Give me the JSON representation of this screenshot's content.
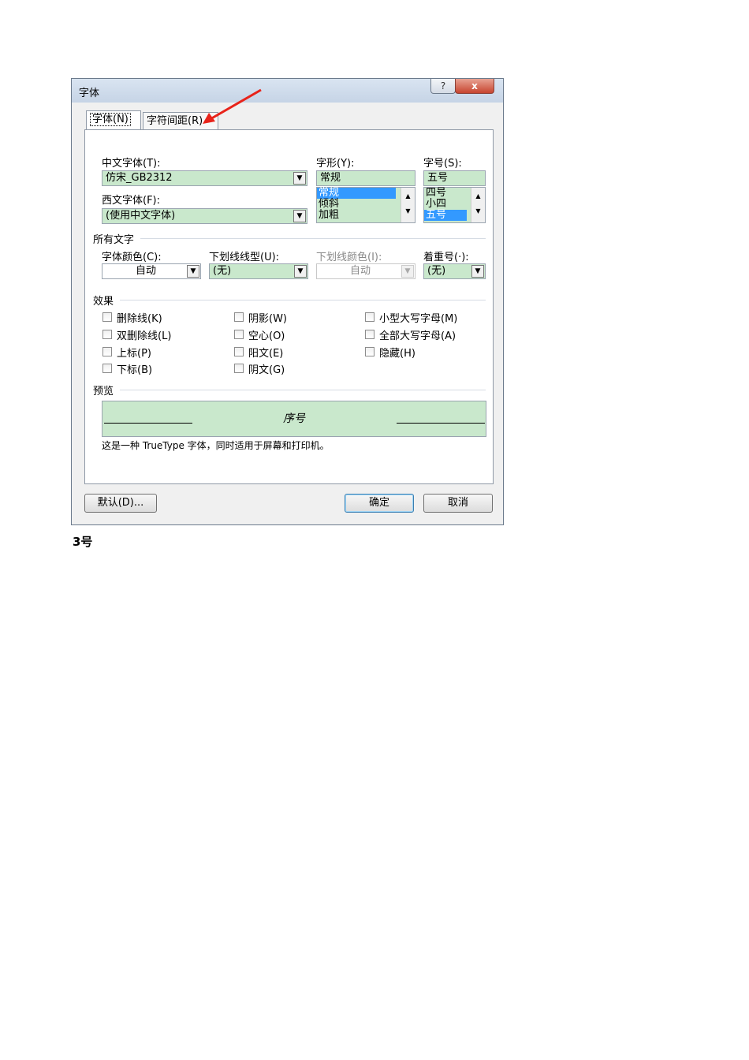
{
  "dialog": {
    "title": "字体",
    "help_label": "?",
    "close_label": "x",
    "tabs": [
      {
        "label": "字体(N)",
        "active": true
      },
      {
        "label": "字符间距(R)",
        "active": false
      }
    ],
    "font_section": {
      "chinese_font_label": "中文字体(T):",
      "chinese_font_value": "仿宋_GB2312",
      "western_font_label": "西文字体(F):",
      "western_font_value": "(使用中文字体)",
      "style_label": "字形(Y):",
      "style_value": "常规",
      "style_options": [
        "常规",
        "倾斜",
        "加粗"
      ],
      "style_selected": "常规",
      "size_label": "字号(S):",
      "size_value": "五号",
      "size_options": [
        "四号",
        "小四",
        "五号"
      ],
      "size_selected": "五号"
    },
    "all_text": {
      "heading": "所有文字",
      "font_color_label": "字体颜色(C):",
      "font_color_value": "自动",
      "underline_type_label": "下划线线型(U):",
      "underline_type_value": "(无)",
      "underline_color_label": "下划线颜色(I):",
      "underline_color_value": "自动",
      "emphasis_label": "着重号(·):",
      "emphasis_value": "(无)"
    },
    "effects": {
      "heading": "效果",
      "items": [
        "删除线(K)",
        "阴影(W)",
        "小型大写字母(M)",
        "双删除线(L)",
        "空心(O)",
        "全部大写字母(A)",
        "上标(P)",
        "阳文(E)",
        "隐藏(H)",
        "下标(B)",
        "阴文(G)"
      ]
    },
    "preview": {
      "heading": "预览",
      "sample_text": "序号",
      "description": "这是一种 TrueType 字体，同时适用于屏幕和打印机。"
    },
    "buttons": {
      "default_label": "默认(D)...",
      "ok_label": "确定",
      "cancel_label": "取消"
    }
  },
  "caption": "3号",
  "colors": {
    "field_green": "#c9e8cc",
    "selection_blue": "#3399ff",
    "annotation_arrow": "#e8231a"
  },
  "icons": {
    "annotation": "red-arrow-icon",
    "dropdown": "chevron-down-icon"
  }
}
